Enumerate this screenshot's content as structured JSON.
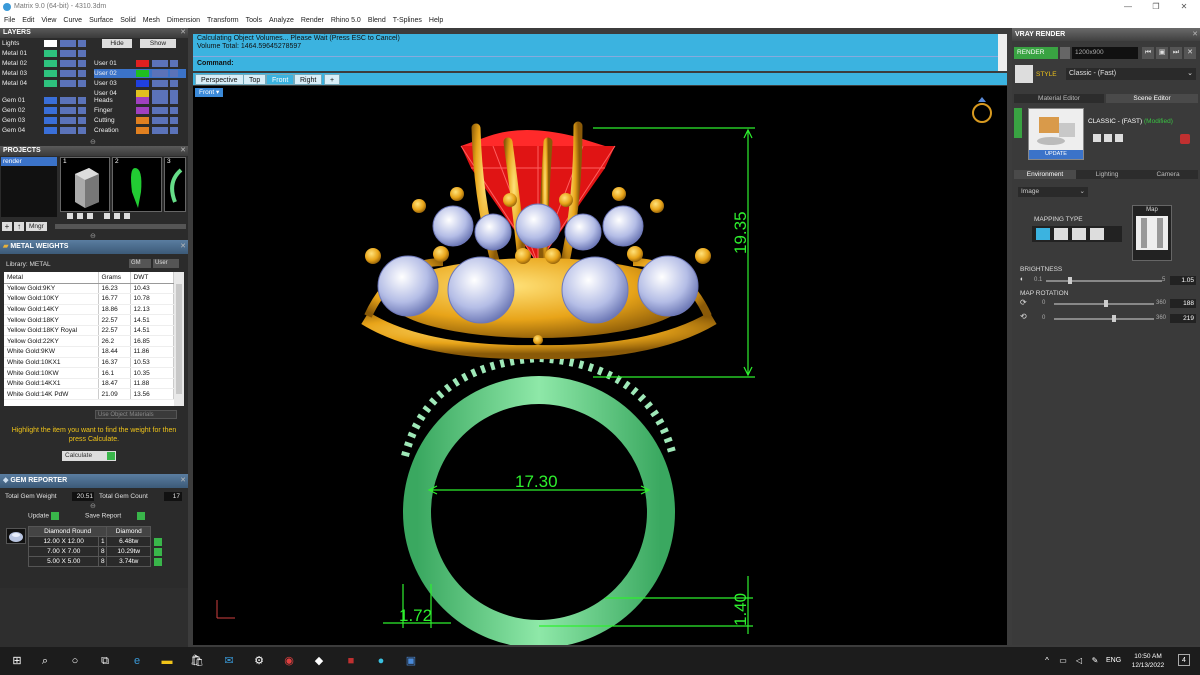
{
  "window": {
    "title": "Matrix 9.0 (64-bit) - 4310.3dm"
  },
  "menu": [
    "File",
    "Edit",
    "View",
    "Curve",
    "Surface",
    "Solid",
    "Mesh",
    "Dimension",
    "Transform",
    "Tools",
    "Analyze",
    "Render",
    "Rhino 5.0",
    "Blend",
    "T-Splines",
    "Help"
  ],
  "layers": {
    "title": "LAYERS",
    "hide_label": "Hide",
    "show_label": "Show",
    "left": [
      {
        "name": "Lights",
        "color": "#ffffff"
      },
      {
        "name": "Metal 01",
        "color": "#2ec27e"
      },
      {
        "name": "Metal 02",
        "color": "#2ec27e"
      },
      {
        "name": "Metal 03",
        "color": "#2ec27e"
      },
      {
        "name": "Metal 04",
        "color": "#2ec27e"
      },
      {
        "name": "Gem 01",
        "color": "#3a6fd8"
      },
      {
        "name": "Gem 02",
        "color": "#3a6fd8"
      },
      {
        "name": "Gem 03",
        "color": "#3a6fd8"
      },
      {
        "name": "Gem 04",
        "color": "#3a6fd8"
      }
    ],
    "right": [
      {
        "name": "User 01",
        "color": "#e02020"
      },
      {
        "name": "User 02",
        "color": "#20c020"
      },
      {
        "name": "User 03",
        "color": "#2040e0"
      },
      {
        "name": "User 04",
        "color": "#e0c020"
      },
      {
        "name": "Heads",
        "color": "#a040c0"
      },
      {
        "name": "Finger",
        "color": "#a040c0"
      },
      {
        "name": "Cutting",
        "color": "#e08020"
      },
      {
        "name": "Creation",
        "color": "#e08020"
      }
    ]
  },
  "projects": {
    "title": "PROJECTS",
    "items": [
      "render"
    ],
    "thumbs": [
      "1",
      "2",
      "3"
    ],
    "manager_label": "Mngr"
  },
  "metal_weights": {
    "title": "METAL WEIGHTS",
    "library_label": "Library: METAL",
    "gm_label": "GM",
    "user_label": "User",
    "columns": [
      "Metal",
      "Grams",
      "DWT"
    ],
    "rows": [
      [
        "Yellow Gold:9KY",
        "16.23",
        "10.43"
      ],
      [
        "Yellow Gold:10KY",
        "16.77",
        "10.78"
      ],
      [
        "Yellow Gold:14KY",
        "18.86",
        "12.13"
      ],
      [
        "Yellow Gold:18KY",
        "22.57",
        "14.51"
      ],
      [
        "Yellow Gold:18KY Royal",
        "22.57",
        "14.51"
      ],
      [
        "Yellow Gold:22KY",
        "26.2",
        "16.85"
      ],
      [
        "White Gold:9KW",
        "18.44",
        "11.86"
      ],
      [
        "White Gold:10KX1",
        "16.37",
        "10.53"
      ],
      [
        "White Gold:10KW",
        "16.1",
        "10.35"
      ],
      [
        "White Gold:14KX1",
        "18.47",
        "11.88"
      ],
      [
        "White Gold:14K PdW",
        "21.09",
        "13.56"
      ]
    ],
    "use_object_materials": "Use Object Materials",
    "hint": "Highlight the item you want to find the weight for then press Calculate.",
    "calculate_label": "Calculate"
  },
  "gem_reporter": {
    "title": "GEM REPORTER",
    "total_weight_label": "Total Gem Weight",
    "total_weight_value": "20.51",
    "total_count_label": "Total Gem Count",
    "total_count_value": "17",
    "update_label": "Update",
    "save_report_label": "Save Report",
    "columns": [
      "Diamond Round",
      "Diamond"
    ],
    "rows": [
      [
        "12.00 X 12.00",
        "1",
        "6.48tw"
      ],
      [
        "7.00 X 7.00",
        "8",
        "10.29tw"
      ],
      [
        "5.00 X 5.00",
        "8",
        "3.74tw"
      ]
    ]
  },
  "command": {
    "line1": "Calculating Object Volumes... Please Wait (Press ESC to Cancel)",
    "line2": "Volume Total: 1464.59645278597",
    "prompt": "Command:"
  },
  "viewport_tabs": [
    "Perspective",
    "Top",
    "Front",
    "Right"
  ],
  "active_tab": "Front",
  "viewport_label": "Front",
  "dimensions": {
    "height": "19.35",
    "inner": "17.30",
    "band_width": "1.72",
    "band_thickness": "1.40"
  },
  "vray": {
    "title": "VRAY RENDER",
    "render_label": "RENDER",
    "resolution": "1200x900",
    "style_label": "STYLE",
    "style_value": "Classic - (Fast)",
    "tab_material": "Material Editor",
    "tab_scene": "Scene Editor",
    "scene_name": "CLASSIC - (FAST)",
    "modified": "(Modified)",
    "update_label": "UPDATE",
    "env_tabs": [
      "Environment",
      "Lighting",
      "Camera"
    ],
    "env_type": "Image",
    "mapping_type_label": "MAPPING TYPE",
    "map_label": "Map",
    "brightness_label": "BRIGHTNESS",
    "brightness_min": "0.1",
    "brightness_max": "5",
    "brightness_value": "1.05",
    "brightness_frac": 0.2,
    "map_rotation_label": "MAP ROTATION",
    "rot1_min": "0",
    "rot1_max": "360",
    "rot1_value": "188",
    "rot2_min": "0",
    "rot2_max": "360",
    "rot2_value": "219"
  },
  "taskbar": {
    "lang": "ENG",
    "time": "10:50 AM",
    "date": "12/13/2022",
    "notif_count": "4"
  },
  "colors": {
    "accent": "#3bb3e0",
    "dim": "#2ef02e",
    "gem_red": "#e01414",
    "metal_gold": "#e8a419",
    "band_green": "#5ed47e"
  }
}
